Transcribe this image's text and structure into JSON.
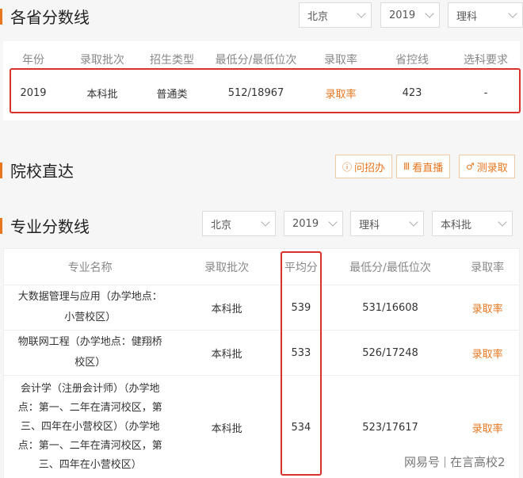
{
  "province_section": {
    "title": "各省分数线",
    "filters": {
      "province": "北京",
      "year": "2019",
      "subject": "理科"
    },
    "columns": [
      "年份",
      "录取批次",
      "招生类型",
      "最低分/最低位次",
      "录取率",
      "省控线",
      "选科要求"
    ],
    "row": {
      "year": "2019",
      "batch": "本科批",
      "type": "普通类",
      "min": "512/18967",
      "rate": "录取率",
      "control": "423",
      "req": "-"
    }
  },
  "school_section": {
    "title": "院校直达",
    "buttons": {
      "ask": "问招办",
      "live": "看直播",
      "test": "测录取"
    }
  },
  "major_section": {
    "title": "专业分数线",
    "filters": {
      "province": "北京",
      "year": "2019",
      "subject": "理科",
      "batch": "本科批"
    },
    "columns": [
      "专业名称",
      "录取批次",
      "平均分",
      "最低分/最低位次",
      "录取率"
    ],
    "rows": [
      {
        "name": "大数据管理与应用（办学地点：小营校区）",
        "batch": "本科批",
        "avg": "539",
        "min": "531/16608",
        "rate": "录取率"
      },
      {
        "name": "物联网工程（办学地点：健翔桥校区）",
        "batch": "本科批",
        "avg": "533",
        "min": "526/17248",
        "rate": "录取率"
      },
      {
        "name": "会计学（注册会计师）（办学地点：第一、二年在清河校区，第三、四年在小营校区）（办学地点：第一、二年在清河校区，第三、四年在小营校区）",
        "batch": "本科批",
        "avg": "534",
        "min": "523/17617",
        "rate": "录取率"
      }
    ]
  },
  "watermark": {
    "left": "网易号",
    "right": "在言高校2"
  },
  "colors": {
    "accent": "#e8761f",
    "highlight": "#d9312b"
  }
}
